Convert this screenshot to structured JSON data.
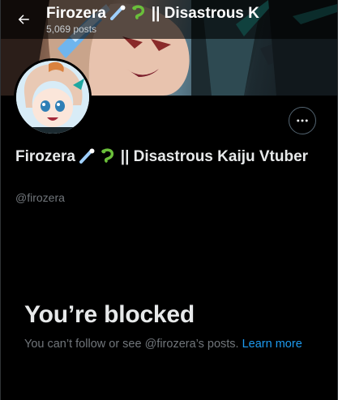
{
  "header": {
    "name": "Firozera",
    "name_suffix": "|| Disastrous K",
    "post_count": "5,069 posts",
    "back_icon": "arrow-left-icon"
  },
  "profile": {
    "name": "Firozera",
    "name_suffix": "|| Disastrous Kaiju Vtuber",
    "handle": "@firozera",
    "emoji": [
      "comet-emoji",
      "lizard-emoji"
    ]
  },
  "actions": {
    "more_icon": "more-horizontal-icon"
  },
  "blocked": {
    "title": "You’re blocked",
    "message": "You can’t follow or see @firozera’s posts.",
    "learn_more": "Learn more"
  },
  "colors": {
    "background": "#000000",
    "text_primary": "#e7e9ea",
    "text_secondary": "#71767b",
    "link": "#1d9bf0"
  }
}
